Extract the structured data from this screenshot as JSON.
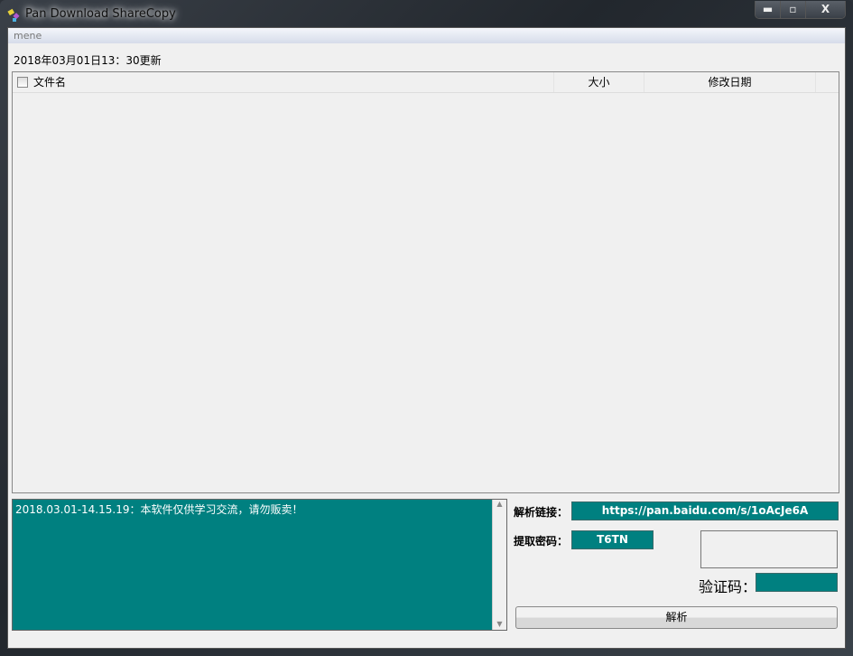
{
  "window": {
    "title": "Pan Download ShareCopy",
    "minimize": "▬",
    "maximize": "▫",
    "close": "X"
  },
  "menu": {
    "label": "mene"
  },
  "updated": "2018年03月01日13：30更新",
  "list": {
    "columns": [
      "文件名",
      "大小",
      "修改日期"
    ]
  },
  "log": {
    "lines": [
      "2018.03.01-14.15.19：本软件仅供学习交流，请勿贩卖！"
    ]
  },
  "form": {
    "link_label": "解析链接：",
    "link_value": "https://pan.baidu.com/s/1oAcJe6A",
    "code_label": "提取密码：",
    "code_value": "T6TN",
    "captcha_label": "验证码：",
    "captcha_value": "",
    "parse_button": "解析"
  }
}
